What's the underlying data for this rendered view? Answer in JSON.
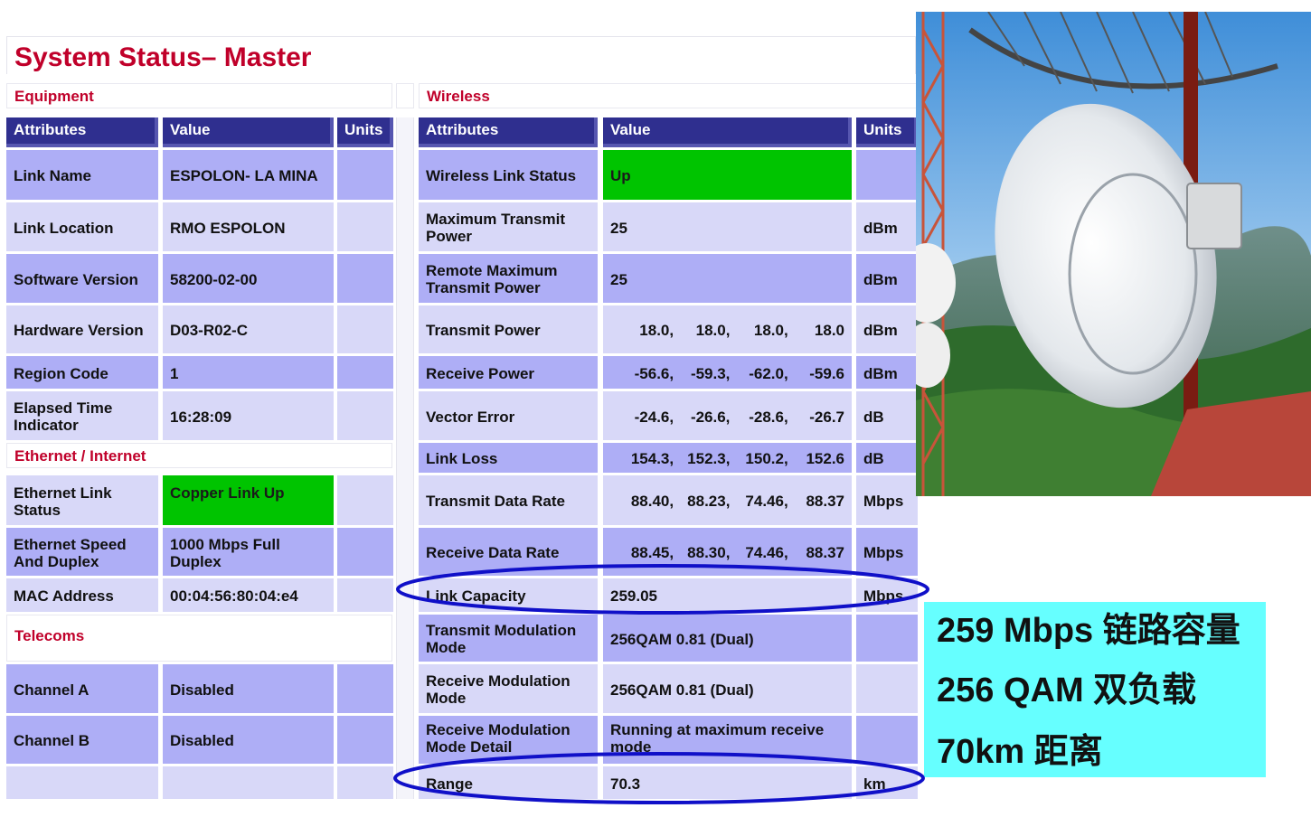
{
  "title": "System Status– Master",
  "equipment": {
    "label": "Equipment",
    "headers": [
      "Attributes",
      "Value",
      "Units"
    ],
    "rows": [
      {
        "attr": "Link Name",
        "value": "ESPOLON- LA MINA",
        "units": ""
      },
      {
        "attr": "Link Location",
        "value": "RMO ESPOLON",
        "units": ""
      },
      {
        "attr": "Software Version",
        "value": "58200-02-00",
        "units": ""
      },
      {
        "attr": "Hardware Version",
        "value": "D03-R02-C",
        "units": ""
      },
      {
        "attr": "Region Code",
        "value": "1",
        "units": ""
      },
      {
        "attr": "Elapsed Time Indicator",
        "value": "16:28:09",
        "units": ""
      }
    ]
  },
  "ethernet": {
    "label": "Ethernet / Internet",
    "rows": [
      {
        "attr": "Ethernet Link Status",
        "value": "Copper Link Up",
        "units": ""
      },
      {
        "attr": "Ethernet Speed And Duplex",
        "value": "1000 Mbps Full Duplex",
        "units": ""
      },
      {
        "attr": "MAC Address",
        "value": "00:04:56:80:04:e4",
        "units": ""
      }
    ]
  },
  "telecoms": {
    "label": "Telecoms",
    "rows": [
      {
        "attr": "Channel A",
        "value": "Disabled",
        "units": ""
      },
      {
        "attr": "Channel B",
        "value": "Disabled",
        "units": ""
      }
    ]
  },
  "wireless": {
    "label": "Wireless",
    "headers": [
      "Attributes",
      "Value",
      "Units"
    ],
    "rows": [
      {
        "attr": "Wireless Link Status",
        "value": "Up",
        "units": ""
      },
      {
        "attr": "Maximum Transmit Power",
        "value": "25",
        "units": "dBm"
      },
      {
        "attr": "Remote Maximum Transmit Power",
        "value": "25",
        "units": "dBm"
      },
      {
        "attr": "Transmit Power",
        "values": [
          "18.0,",
          "18.0,",
          "18.0,",
          "18.0"
        ],
        "units": "dBm"
      },
      {
        "attr": "Receive Power",
        "values": [
          "-56.6,",
          "-59.3,",
          "-62.0,",
          "-59.6"
        ],
        "units": "dBm"
      },
      {
        "attr": "Vector Error",
        "values": [
          "-24.6,",
          "-26.6,",
          "-28.6,",
          "-26.7"
        ],
        "units": "dB"
      },
      {
        "attr": "Link Loss",
        "values": [
          "154.3,",
          "152.3,",
          "150.2,",
          "152.6"
        ],
        "units": "dB"
      },
      {
        "attr": "Transmit Data Rate",
        "values": [
          "88.40,",
          "88.23,",
          "74.46,",
          "88.37"
        ],
        "units": "Mbps"
      },
      {
        "attr": "Receive Data Rate",
        "values": [
          "88.45,",
          "88.30,",
          "74.46,",
          "88.37"
        ],
        "units": "Mbps"
      },
      {
        "attr": "Link Capacity",
        "value": "259.05",
        "units": "Mbps"
      },
      {
        "attr": "Transmit Modulation Mode",
        "value": "256QAM 0.81 (Dual)",
        "units": ""
      },
      {
        "attr": "Receive Modulation Mode",
        "value": "256QAM 0.81 (Dual)",
        "units": ""
      },
      {
        "attr": "Receive Modulation Mode Detail",
        "value": "Running at maximum receive mode",
        "units": ""
      },
      {
        "attr": "Range",
        "value": "70.3",
        "units": "km"
      }
    ]
  },
  "callout": {
    "line1": "259 Mbps 链路容量",
    "line2": "256 QAM 双负载",
    "line3": "70km 距离"
  },
  "colors": {
    "accent_red": "#c0002a",
    "header_navy": "#2f2f8f",
    "row_dark": "#aeaef6",
    "row_light": "#d8d8f8",
    "status_green": "#00c400",
    "callout_cyan": "#66ffff",
    "highlight_ellipse": "#1010c8"
  },
  "photo": {
    "icon": "microwave-dish-antenna-photo"
  }
}
